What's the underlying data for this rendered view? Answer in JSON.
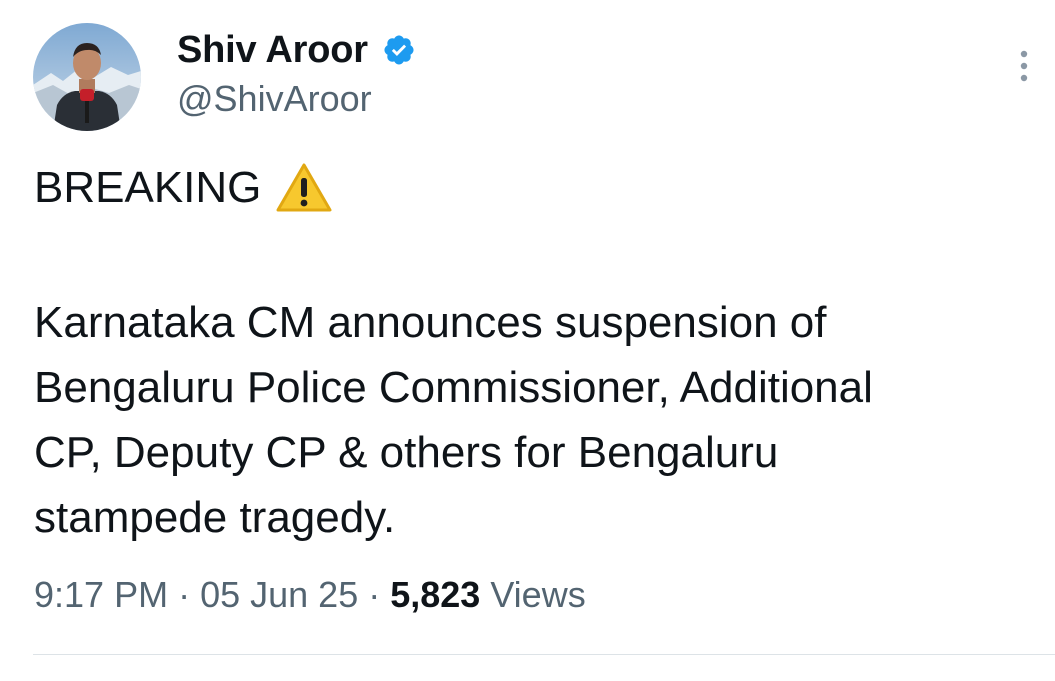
{
  "author": {
    "display_name": "Shiv Aroor",
    "handle": "@ShivAroor",
    "verified": true,
    "avatar_icon": "profile-photo",
    "verified_icon": "verified-badge-icon",
    "verified_color": "#1d9bf0"
  },
  "tweet": {
    "headline": "BREAKING",
    "headline_icon": "warning-sign-emoji",
    "body_lines": [
      "Karnataka CM announces suspension of",
      "Bengaluru Police Commissioner, Additional",
      "CP, Deputy CP & others for Bengaluru",
      "stampede tragedy."
    ]
  },
  "meta": {
    "time": "9:17 PM",
    "separator": "·",
    "date": "05 Jun 25",
    "views_count": "5,823",
    "views_label": "Views"
  },
  "menu_icon": "more-options-icon",
  "colors": {
    "text_primary": "#0f1419",
    "text_secondary": "#536471",
    "divider": "#dde3e7"
  }
}
